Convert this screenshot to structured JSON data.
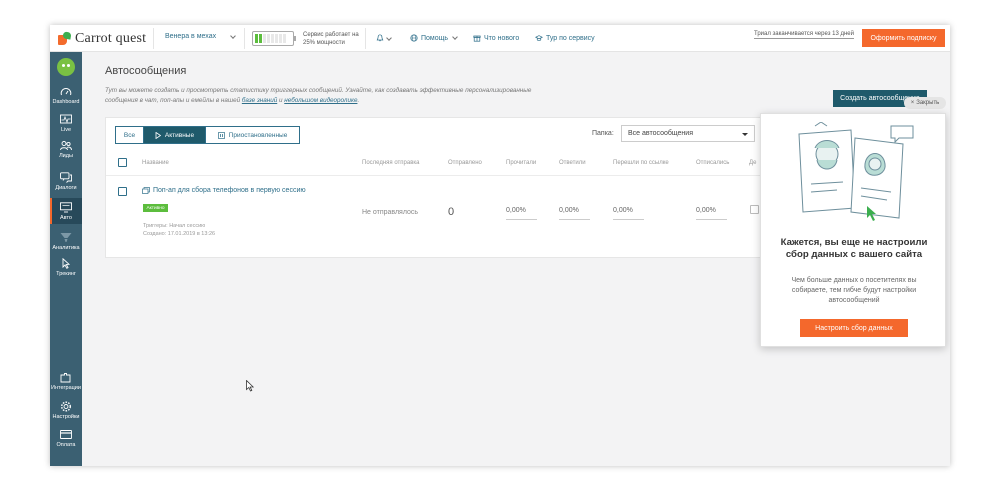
{
  "header": {
    "logo_text": "Carrot quest",
    "project_name": "Венера в мехах",
    "service_line1": "Сервис работает на",
    "service_line2": "25% мощности",
    "battery_level": 0.25,
    "help_label": "Помощь",
    "whats_new_label": "Что нового",
    "tour_label": "Тур по сервису",
    "trial_text": "Триал заканчивается через 13 дней",
    "subscribe_label": "Оформить подписку"
  },
  "sidebar": {
    "items": [
      {
        "label": "Dashboard",
        "icon": "gauge-icon"
      },
      {
        "label": "Live",
        "icon": "pulse-icon"
      },
      {
        "label": "Лиды",
        "icon": "users-icon"
      },
      {
        "label": "Диалоги",
        "icon": "chat-icon"
      },
      {
        "label": "Авто",
        "icon": "monitor-icon"
      },
      {
        "label": "Аналитика",
        "icon": "funnel-icon"
      },
      {
        "label": "Трекинг",
        "icon": "cursor-icon"
      },
      {
        "label": "Интеграции",
        "icon": "puzzle-icon"
      },
      {
        "label": "Настройки",
        "icon": "gear-icon"
      },
      {
        "label": "Оплата",
        "icon": "card-icon"
      }
    ],
    "active": "Авто"
  },
  "main": {
    "title": "Автосообщения",
    "desc_text1": "Тут вы можете создать и просмотреть статистику триггерных сообщений. Узнайте, как создавать эффективные персонализированные",
    "desc_text2": "сообщения в чат, поп-апы и емейлы в нашей ",
    "desc_link1": "базе знаний",
    "desc_and": " и ",
    "desc_link2": "небольшом видеоролике",
    "desc_end": ".",
    "create_label": "Создать автосообщение",
    "filters": {
      "all": "Все",
      "active": "Активные",
      "paused": "Приостановленные"
    },
    "folder_label": "Папка:",
    "folder_value": "Все автосообщения",
    "columns": [
      "Название",
      "Последняя отправка",
      "Отправлено",
      "Прочитали",
      "Ответили",
      "Перешли по ссылке",
      "Отписались",
      "Де"
    ],
    "row": {
      "title": "Поп-ап для сбора телефонов в первую сессию",
      "status": "Активно",
      "triggers": "Триггеры: Начал сессию",
      "created": "Создано: 17.01.2019 в 13:26",
      "last_sent": "Не отправлялось",
      "sent": "0",
      "read": "0,00%",
      "replied": "0,00%",
      "clicked": "0,00%",
      "unsubscribed": "0,00%"
    }
  },
  "popup": {
    "close_label": "Закрыть",
    "title": "Кажется, вы еще не настроили сбор данных с вашего сайта",
    "text": "Чем больше данных о посетителях вы собираете, тем гибче будут настройки автосообщений",
    "button": "Настроить сбор данных"
  }
}
